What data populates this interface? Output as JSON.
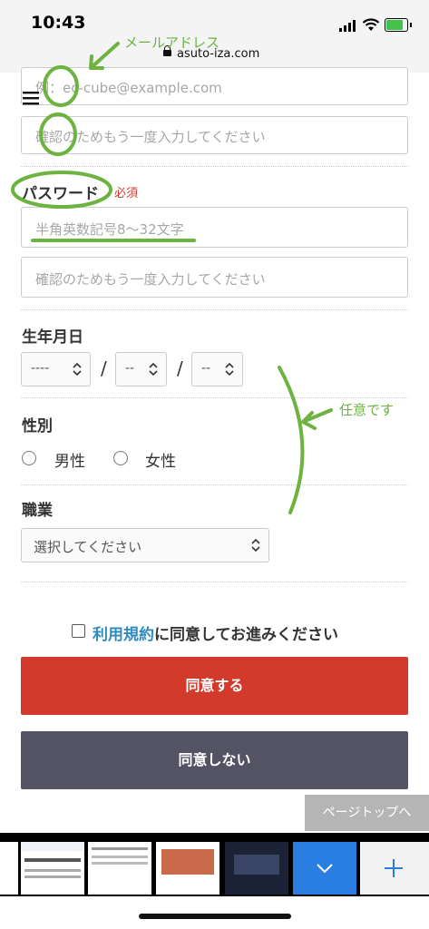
{
  "status_bar": {
    "time": "10:43",
    "url": "asuto-iza.com"
  },
  "annotations": {
    "email": "メールアドレス",
    "optional": "任意です"
  },
  "email": {
    "placeholder": "例：ec-cube@example.com",
    "confirm_placeholder": "確認のためもう一度入力してください"
  },
  "password": {
    "label": "パスワード",
    "required": "必須",
    "placeholder": "半角英数記号8〜32文字",
    "confirm_placeholder": "確認のためもう一度入力してください"
  },
  "birthday": {
    "label": "生年月日",
    "year": "----",
    "month": "--",
    "day": "--",
    "separator": "/"
  },
  "gender": {
    "label": "性別",
    "male": "男性",
    "female": "女性"
  },
  "job": {
    "label": "職業",
    "value": "選択してください"
  },
  "terms": {
    "link": "利用規約",
    "text": "に同意してお進みください"
  },
  "buttons": {
    "agree": "同意する",
    "disagree": "同意しない",
    "page_top": "ページトップへ"
  },
  "colors": {
    "agree_bg": "#d23a2c",
    "disagree_bg": "#545363",
    "annotation": "#6db33f",
    "link": "#2f8bbd"
  }
}
